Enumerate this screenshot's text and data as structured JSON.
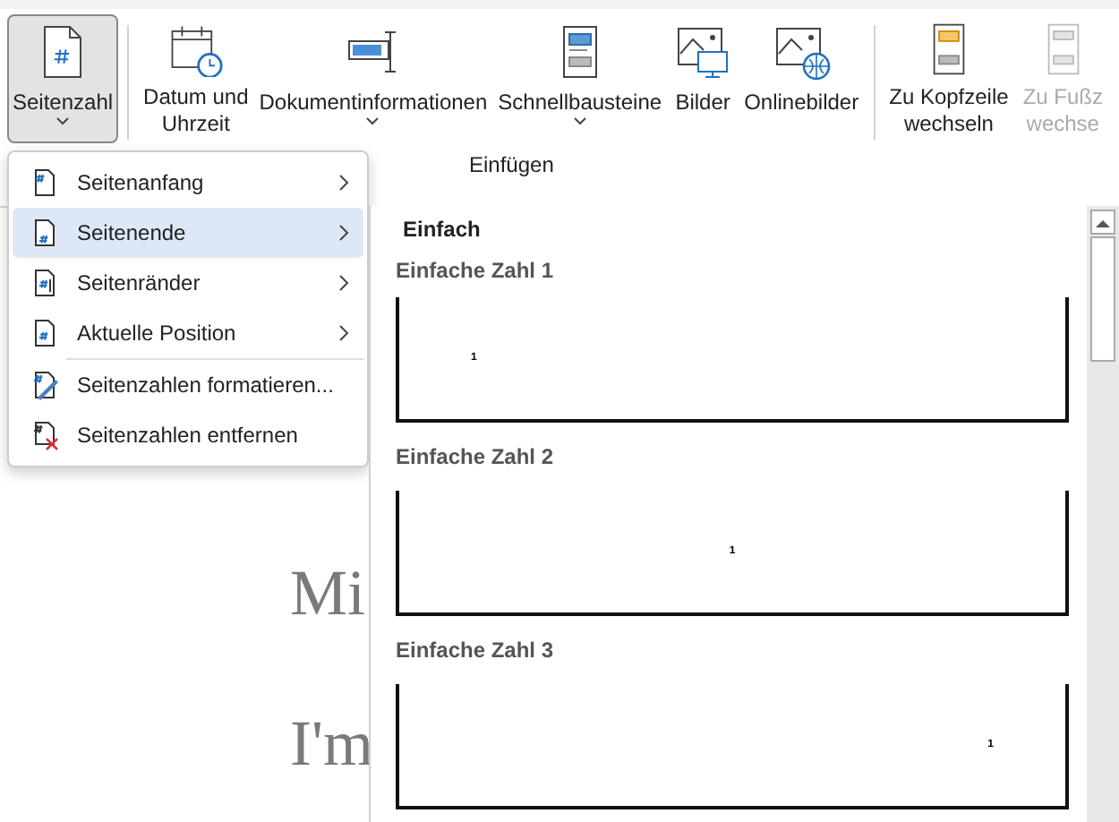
{
  "ribbon": {
    "buttons": [
      {
        "label_lines": [
          "Seitenzahl"
        ],
        "dropdown": true,
        "pressed": true,
        "disabled": false
      },
      {
        "label_lines": [
          "Datum und",
          "Uhrzeit"
        ],
        "dropdown": false,
        "pressed": false,
        "disabled": false
      },
      {
        "label_lines": [
          "Dokumentinformationen"
        ],
        "dropdown": true,
        "pressed": false,
        "disabled": false
      },
      {
        "label_lines": [
          "Schnellbausteine"
        ],
        "dropdown": true,
        "pressed": false,
        "disabled": false
      },
      {
        "label_lines": [
          "Bilder"
        ],
        "dropdown": false,
        "pressed": false,
        "disabled": false
      },
      {
        "label_lines": [
          "Onlinebilder"
        ],
        "dropdown": false,
        "pressed": false,
        "disabled": false
      },
      {
        "label_lines": [
          "Zu Kopfzeile",
          "wechseln"
        ],
        "dropdown": false,
        "pressed": false,
        "disabled": false
      },
      {
        "label_lines": [
          "Zu Fußz",
          "wechse"
        ],
        "dropdown": false,
        "pressed": false,
        "disabled": true
      }
    ],
    "group_label": "Einfügen"
  },
  "menu": {
    "groups": [
      [
        {
          "label": "Seitenanfang",
          "submenu": true,
          "selected": false
        },
        {
          "label": "Seitenende",
          "submenu": true,
          "selected": true
        },
        {
          "label": "Seitenränder",
          "submenu": true,
          "selected": false
        },
        {
          "label": "Aktuelle Position",
          "submenu": true,
          "selected": false
        }
      ],
      [
        {
          "label": "Seitenzahlen formatieren...",
          "submenu": false,
          "selected": false
        },
        {
          "label": "Seitenzahlen entfernen",
          "submenu": false,
          "selected": false
        }
      ]
    ]
  },
  "gallery": {
    "heading": "Einfach",
    "items": [
      {
        "label": "Einfache Zahl 1",
        "number": "1"
      },
      {
        "label": "Einfache Zahl 2",
        "number": "1"
      },
      {
        "label": "Einfache Zahl 3",
        "number": "1"
      }
    ]
  },
  "document": {
    "lines": [
      "Mi",
      "I'm"
    ]
  }
}
